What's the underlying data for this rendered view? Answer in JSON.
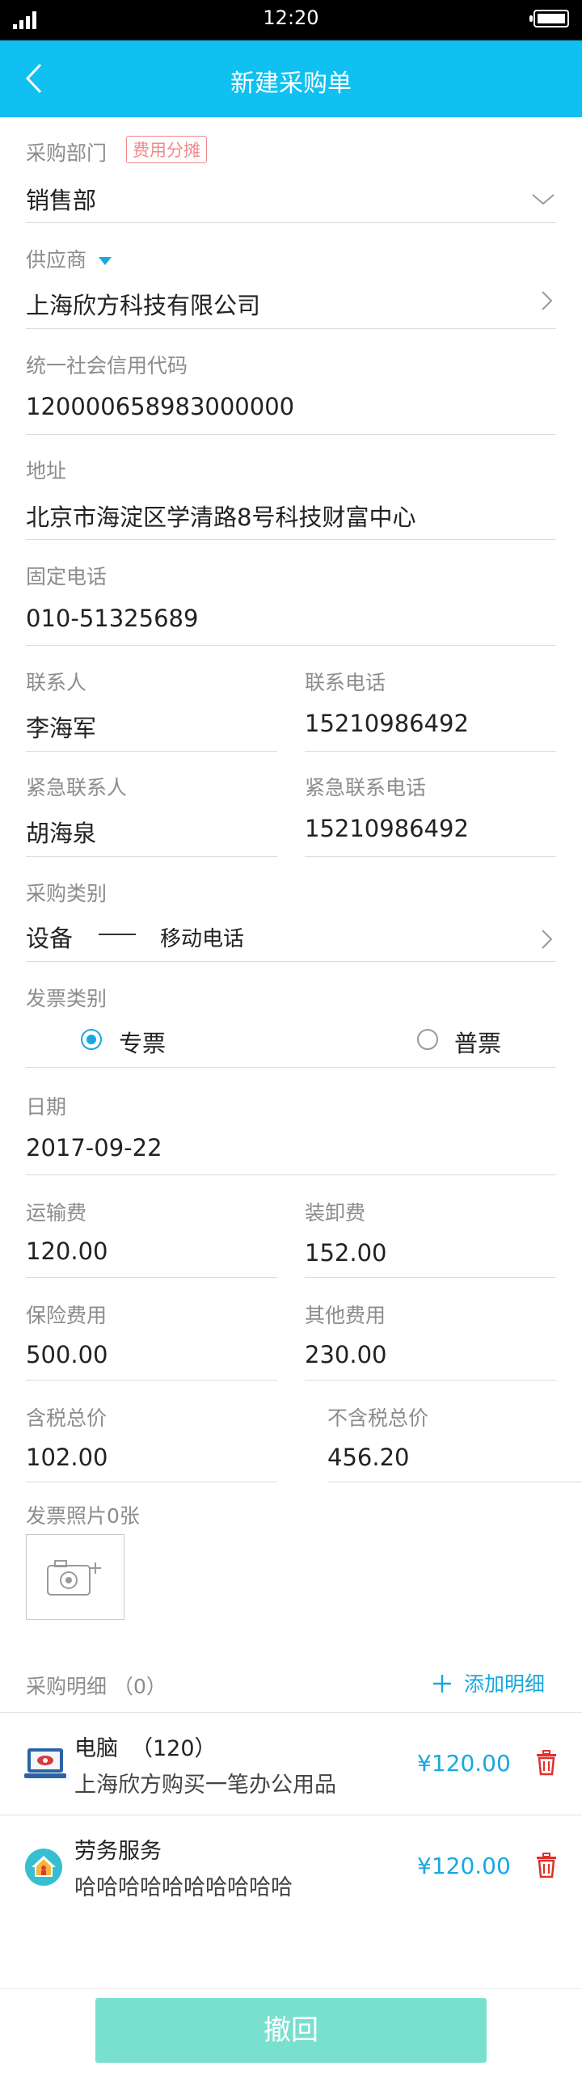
{
  "status_bar": {
    "time": "12:20"
  },
  "header": {
    "title": "新建采购单"
  },
  "form": {
    "dept": {
      "label": "采购部门",
      "tag": "费用分摊",
      "value": "销售部"
    },
    "supplier": {
      "label": "供应商",
      "value": "上海欣方科技有限公司"
    },
    "credit_code": {
      "label": "统一社会信用代码",
      "value": "120000658983000000"
    },
    "address": {
      "label": "地址",
      "value": "北京市海淀区学清路8号科技财富中心"
    },
    "phone": {
      "label": "固定电话",
      "value": "010-51325689"
    },
    "contact": {
      "label": "联系人",
      "value": "李海军"
    },
    "contact_phone": {
      "label": "联系电话",
      "value": "15210986492"
    },
    "emergency_contact": {
      "label": "紧急联系人",
      "value": "胡海泉"
    },
    "emergency_phone": {
      "label": "紧急联系电话",
      "value": "15210986492"
    },
    "purchase_type": {
      "label": "采购类别",
      "value": "设备",
      "sub_value": "移动电话"
    },
    "invoice_type": {
      "label": "发票类别",
      "option_special": "专票",
      "option_normal": "普票",
      "selected": "专票"
    },
    "date": {
      "label": "日期",
      "value": "2017-09-22"
    },
    "freight": {
      "label": "运输费",
      "value": "120.00"
    },
    "handling": {
      "label": "装卸费",
      "value": "152.00"
    },
    "insurance": {
      "label": "保险费用",
      "value": "500.00"
    },
    "other": {
      "label": "其他费用",
      "value": "230.00"
    },
    "tax_total": {
      "label": "含税总价",
      "value": "102.00"
    },
    "no_tax_total": {
      "label": "不含税总价",
      "value": "456.20"
    },
    "invoice_photos": {
      "label": "发票照片0张"
    }
  },
  "details": {
    "label": "采购明细",
    "count": "（0）",
    "add_label": "添加明细",
    "items": [
      {
        "name": "电脑",
        "qty": "（120）",
        "desc": "上海欣方购买一笔办公用品",
        "price": "¥120.00",
        "icon": "laptop-icon"
      },
      {
        "name": "劳务服务",
        "qty": "",
        "desc": "哈哈哈哈哈哈哈哈哈哈",
        "price": "¥120.00",
        "icon": "house-icon"
      }
    ]
  },
  "footer": {
    "withdraw_label": "撤回"
  },
  "colors": {
    "header": "#0fc0f0",
    "accent": "#1aa7e0",
    "delete": "#e0302a",
    "button": "#79e0cf",
    "tag": "#f08a8a"
  }
}
